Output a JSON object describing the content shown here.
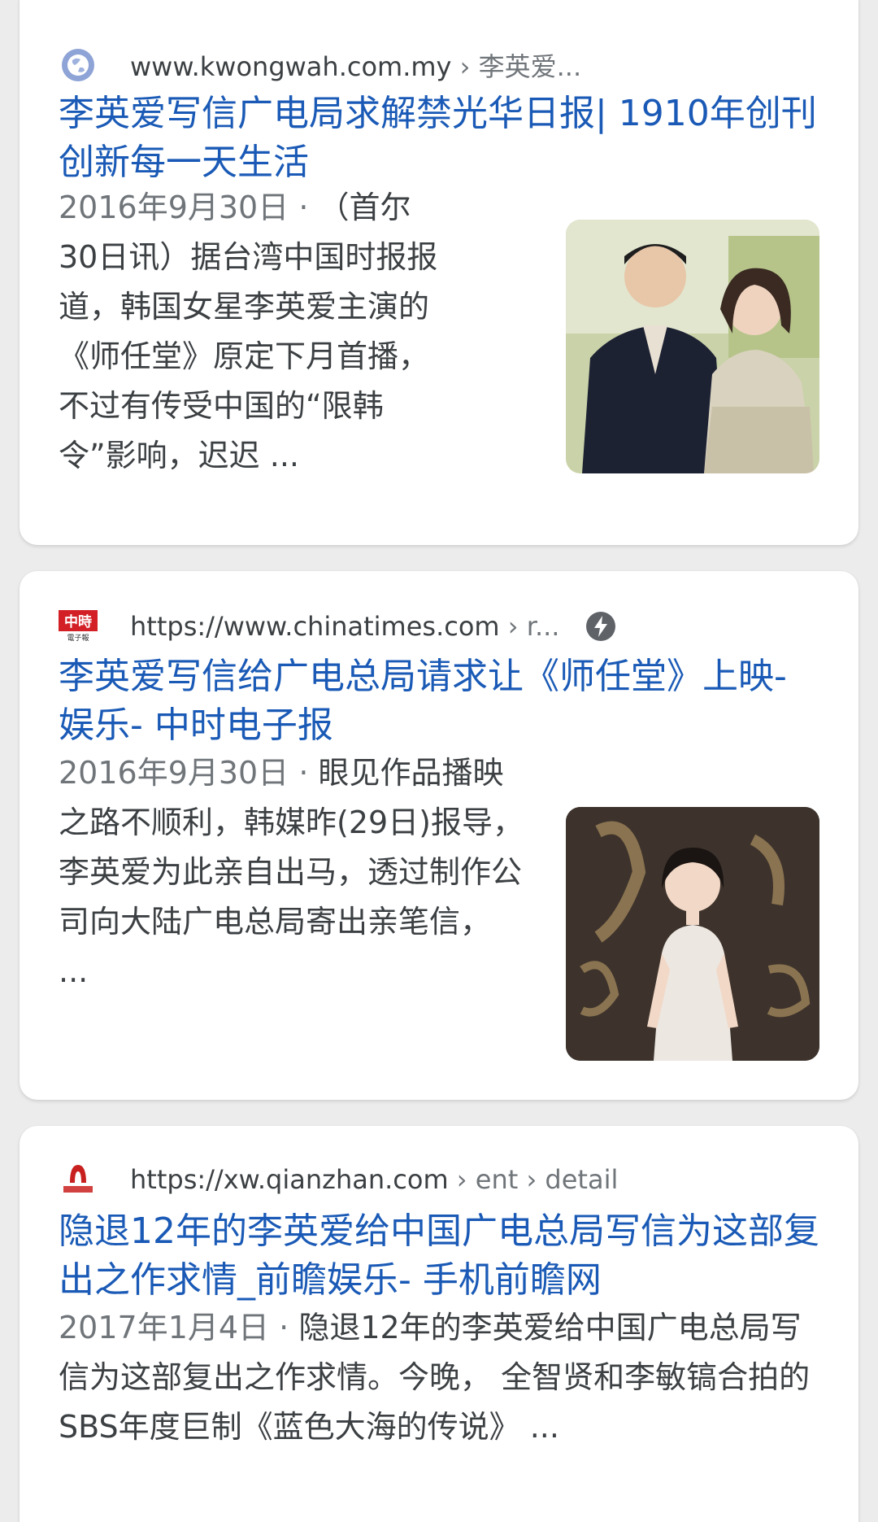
{
  "results": [
    {
      "domain": "www.kwongwah.com.my",
      "breadcrumb": " › 李英爱...",
      "title": "李英爱写信广电局求解禁光华日报| 1910年创刊创新每一天生活",
      "date": "2016年9月30日",
      "separator": " · ",
      "snippet": "（首尔30日讯）据台湾中国时报报道，韩国女星李英爱主演的《师任堂》原定下月首播，不过有传受中国的“限韩令”影响，迟迟 ...",
      "favicon": "globe-icon",
      "thumbnail": "couple-photo"
    },
    {
      "domain": "https://www.chinatimes.com",
      "breadcrumb": " › r...",
      "title": "李英爱写信给广电总局请求让《师任堂》上映- 娱乐- 中时电子报",
      "date": "2016年9月30日",
      "separator": " · ",
      "snippet": "眼见作品播映之路不顺利，韩媒昨(29日)报导，李英爱为此亲自出马，透过制作公司向大陆广电总局寄出亲笔信， ...",
      "favicon": "chinatimes-logo",
      "favicon_text_top": "中時",
      "favicon_text_bottom": "電子報",
      "amp": "amp-bolt-icon",
      "thumbnail": "actress-photo"
    },
    {
      "domain": "https://xw.qianzhan.com",
      "breadcrumb": " › ent › detail",
      "title": "隐退12年的李英爱给中国广电总局写信为这部复出之作求情_前瞻娱乐- 手机前瞻网",
      "date": "2017年1月4日",
      "separator": " · ",
      "snippet": "隐退12年的李英爱给中国广电总局写信为这部复出之作求情。今晚， 全智贤和李敏镐合拍的SBS年度巨制《蓝色大海的传说》 ...",
      "favicon": "qianzhan-logo"
    }
  ],
  "colors": {
    "title_link": "#1a5ab6",
    "body_text": "#3c4043",
    "meta_text": "#70757a",
    "card_bg": "#ffffff",
    "page_bg": "#ececec"
  }
}
